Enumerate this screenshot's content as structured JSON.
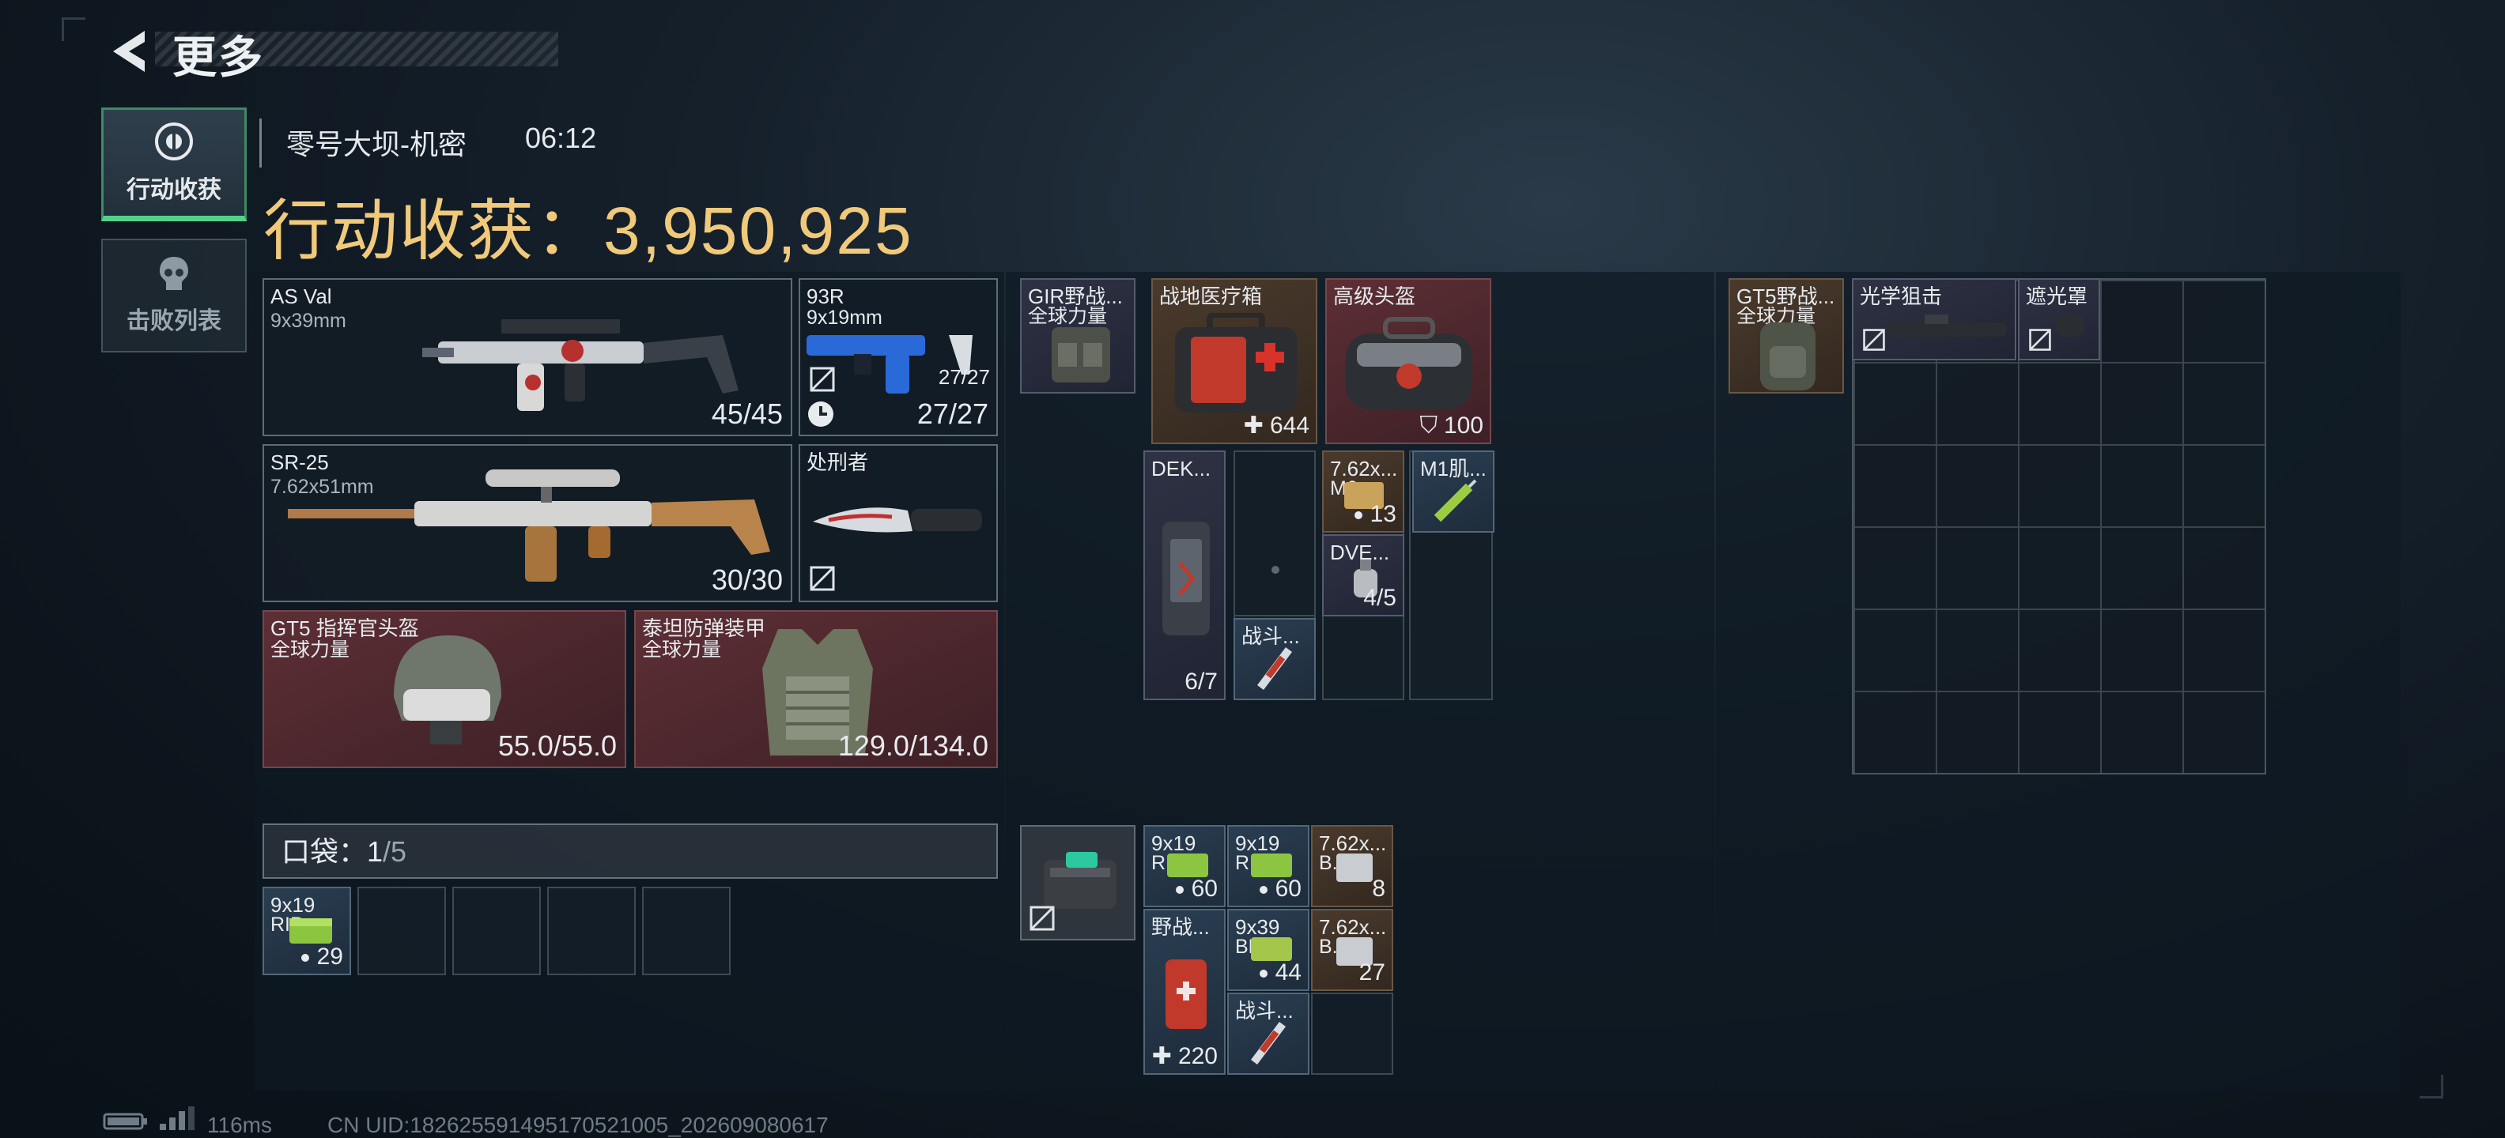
{
  "header": {
    "title": "更多",
    "back_icon": "back-arrow-icon"
  },
  "tabs": [
    {
      "label": "行动收获",
      "icon": "loot-circle-icon",
      "active": true
    },
    {
      "label": "击败列表",
      "icon": "skull-icon",
      "active": false
    }
  ],
  "raid": {
    "map": "零号大坝-机密",
    "time": "06:12",
    "loot_label": "行动收获：",
    "loot_value": "3,950,925"
  },
  "weapons": [
    {
      "name": "AS Val",
      "caliber": "9x39mm",
      "ammo": "45/45"
    },
    {
      "name": "93R",
      "caliber": "9x19mm",
      "ammo_small": "27/27",
      "ammo": "27/27"
    },
    {
      "name": "SR-25",
      "caliber": "7.62x51mm",
      "ammo": "30/30"
    },
    {
      "name": "处刑者"
    }
  ],
  "armor": [
    {
      "name": "GT5 指挥官头盔",
      "brand": "全球力量",
      "durability": "55.0/55.0"
    },
    {
      "name": "泰坦防弹装甲",
      "brand": "全球力量",
      "durability": "129.0/134.0"
    }
  ],
  "pocket": {
    "label": "口袋：",
    "count": "1",
    "max": "/5",
    "items": [
      {
        "name": "9x19",
        "sub": "RIP",
        "qty": "29"
      }
    ]
  },
  "rig": {
    "name": "GIR野战...",
    "brand": "全球力量",
    "items": [
      {
        "name": "战地医疗箱",
        "qty": "644"
      },
      {
        "name": "高级头盔",
        "qty": "100"
      },
      {
        "name": "DEK...",
        "qty": "6/7"
      },
      {
        "name": "7.62x...",
        "sub": "M6...",
        "qty": "13"
      },
      {
        "name": "M1肌..."
      },
      {
        "name": "DVE...",
        "qty": "4/5"
      },
      {
        "name": "战斗..."
      }
    ]
  },
  "safebox": {
    "items": [
      {
        "name": "9x19",
        "sub": "RIP",
        "qty": "60"
      },
      {
        "name": "9x19",
        "sub": "RIP",
        "qty": "60"
      },
      {
        "name": "7.62x...",
        "sub": "B...",
        "qty": "8"
      },
      {
        "name": "野战...",
        "qty": "220"
      },
      {
        "name": "9x39",
        "sub": "BP",
        "qty": "44"
      },
      {
        "name": "7.62x...",
        "sub": "B...",
        "qty": "27"
      },
      {
        "name": "战斗..."
      }
    ]
  },
  "backpack": {
    "name": "GT5野战...",
    "brand": "全球力量",
    "items": [
      {
        "name": "光学狙击"
      },
      {
        "name": "遮光罩"
      }
    ]
  },
  "footer": {
    "ping": "116ms",
    "uid": "CN UID:182625591495170521005_202609080617"
  },
  "colors": {
    "loot_gold": "#f0c97a",
    "active_tab_green": "#54d08a",
    "red_slot": "#5d2f35",
    "brown_slot": "#4a3a2c",
    "blue_slot": "#2a3e52"
  }
}
